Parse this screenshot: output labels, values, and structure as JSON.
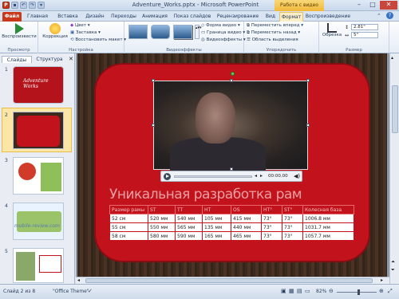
{
  "colors": {
    "accent": "#c2121b",
    "file_tab": "#c8381a",
    "context_header": "#f1b93a"
  },
  "titlebar": {
    "title": "Adventure_Works.pptx - Microsoft PowerPoint",
    "context_header": "Работа с видео",
    "logo": "P"
  },
  "tabs": [
    {
      "label": "Файл"
    },
    {
      "label": "Главная"
    },
    {
      "label": "Вставка"
    },
    {
      "label": "Дизайн"
    },
    {
      "label": "Переходы"
    },
    {
      "label": "Анимация"
    },
    {
      "label": "Показ слайдов"
    },
    {
      "label": "Рецензирование"
    },
    {
      "label": "Вид"
    },
    {
      "label": "Формат"
    },
    {
      "label": "Воспроизведение"
    }
  ],
  "ribbon": {
    "preview": {
      "button": "Воспроизвести",
      "group": "Просмотр"
    },
    "settings": {
      "correction": "Коррекция",
      "color": "Цвет",
      "poster": "Заставка",
      "reset": "Восстановить макет",
      "group": "Настройка"
    },
    "styles": {
      "group": "Видеоэффекты",
      "shape": "Форма видео",
      "border": "Граница видео",
      "effects": "Видеоэффекты"
    },
    "arrange": {
      "forward": "Переместить вперед",
      "backward": "Переместить назад",
      "selection": "Область выделения",
      "group": "Упорядочить"
    },
    "size": {
      "crop": "Обрезка",
      "height": "2.81\"",
      "width": "5\"",
      "group": "Размер"
    }
  },
  "panel": {
    "tab_slides": "Слайды",
    "tab_outline": "Структура",
    "slides": [
      {
        "num": "1"
      },
      {
        "num": "2"
      },
      {
        "num": "3"
      },
      {
        "num": "4"
      },
      {
        "num": "5"
      }
    ],
    "thumb1_title": "Adventure Works",
    "watermark": "mobile-review.com"
  },
  "slide": {
    "headline": "Уникальная разработка рам",
    "player_time": "00:00.00",
    "table": {
      "headers": [
        "Размер рамы",
        "ST",
        "TT",
        "HT",
        "OS",
        "HT°",
        "ST°",
        "Колесная база"
      ],
      "rows": [
        [
          "52 см",
          "520 мм",
          "540 мм",
          "105 мм",
          "415 мм",
          "73°",
          "73°",
          "1006.8 мм"
        ],
        [
          "55 см",
          "550 мм",
          "565 мм",
          "135 мм",
          "440 мм",
          "73°",
          "73°",
          "1031.7 мм"
        ],
        [
          "58 см",
          "580 мм",
          "590 мм",
          "165 мм",
          "465 мм",
          "73°",
          "73°",
          "1057.7 мм"
        ]
      ]
    }
  },
  "statusbar": {
    "slide_info": "Слайд 2 из 8",
    "theme": "\"Office Theme\"",
    "zoom": "82%"
  }
}
